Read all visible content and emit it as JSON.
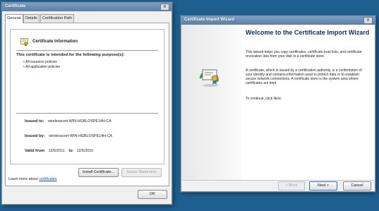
{
  "certificate_dialog": {
    "title": "Certificate",
    "tabs": [
      {
        "label": "General"
      },
      {
        "label": "Details"
      },
      {
        "label": "Certification Path"
      }
    ],
    "info_title": "Certificate Information",
    "purpose_heading": "This certificate is intended for the following purpose(s):",
    "purposes": [
      "All issuance policies",
      "All application policies"
    ],
    "issued_to_label": "Issued to:",
    "issued_to_value": "wirelesscert-WIN-HGBLOSPE14H-CA",
    "issued_by_label": "Issued by:",
    "issued_by_value": "wirelesscert-WIN-HGBLOSPE14H-CA",
    "valid_from_label": "Valid from",
    "valid_from_value": "12/5/2011",
    "valid_to_label": "to",
    "valid_to_value": "12/5/2016",
    "install_button": "Install Certificate...",
    "issuer_statement_button": "Issuer Statement",
    "learn_more_text": "Learn more about",
    "learn_more_link": "certificates",
    "ok_button": "OK",
    "close_glyph": "x"
  },
  "import_wizard": {
    "title": "Certificate Import Wizard",
    "heading": "Welcome to the Certificate Import Wizard",
    "paragraph1": "This wizard helps you copy certificates, certificate trust lists, and certificate revocation lists from your disk to a certificate store.",
    "paragraph2": "A certificate, which is issued by a certification authority, is a confirmation of your identity and contains information used to protect data or to establish secure network connections. A certificate store is the system area where certificates are kept.",
    "paragraph3": "To continue, click Next.",
    "back_button": "< Back",
    "next_button": "Next >",
    "cancel_button": "Cancel",
    "close_glyph": "x"
  },
  "colors": {
    "desktop": "#1f5f8f",
    "titlebar": "#5a7fa6",
    "wizard_heading": "#10306a",
    "link": "#1a44c0"
  }
}
